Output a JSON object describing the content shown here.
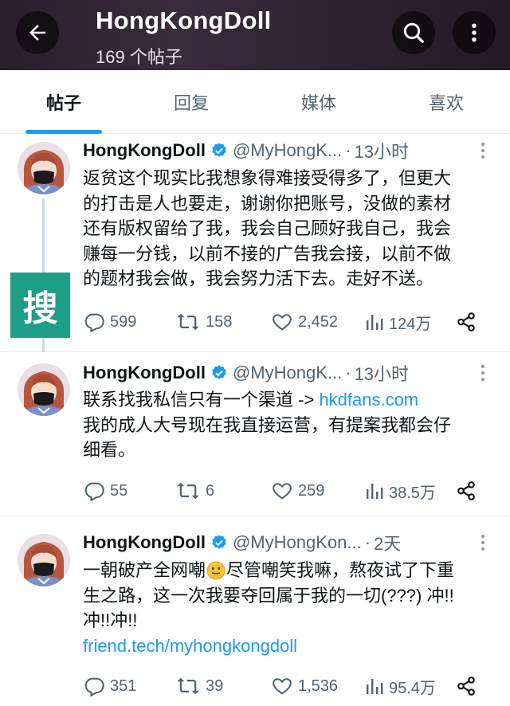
{
  "header": {
    "title": "HongKongDoll",
    "subtitle": "169 个帖子",
    "back_icon": "arrow-left-icon",
    "search_icon": "search-icon",
    "more_icon": "more-vertical-icon"
  },
  "tabs": [
    {
      "label": "帖子",
      "active": true
    },
    {
      "label": "回复",
      "active": false
    },
    {
      "label": "媒体",
      "active": false
    },
    {
      "label": "喜欢",
      "active": false
    }
  ],
  "colors": {
    "accent": "#1d9bf0",
    "text": "#0f1419",
    "muted": "#536471",
    "header_bg": "#2c2130",
    "watermark": "#1e9e86"
  },
  "posts": [
    {
      "name": "HongKongDoll",
      "handle": "@MyHongK...",
      "dot": "·",
      "time": "13小时",
      "lines": [
        "返贫这个现实比我想象得难接受得多了，但更大",
        "的打击是人也要走，谢谢你把账号，没做的素材",
        "还有版权留给了我，我会自己顾好我自己，我会",
        "赚每一分钱，以前不接的广告我会接，以前不做",
        "的题材我会做，我会努力活下去。走好不送。"
      ],
      "replies": "599",
      "reposts": "158",
      "likes": "2,452",
      "views": "124万"
    },
    {
      "name": "HongKongDoll",
      "handle": "@MyHongK...",
      "dot": "·",
      "time": "13小时",
      "line1_text": "联系找我私信只有一个渠道 -> ",
      "line1_link": "hkdfans.com",
      "lines": [
        "我的成人大号现在我直接运营，有提案我都会仔",
        "细看。"
      ],
      "replies": "55",
      "reposts": "6",
      "likes": "259",
      "views": "38.5万"
    },
    {
      "name": "HongKongDoll",
      "handle": "@MyHongKon...",
      "dot": "·",
      "time": "2天",
      "line1_a": "一朝破产全网嘲",
      "line1_b": "尽管嘲笑我嘛，熬夜试了下重",
      "lines": [
        "生之路，这一次我要夺回属于我的一切(???) 冲!!",
        "冲!!冲!!"
      ],
      "link": "friend.tech/myhongkongdoll",
      "replies": "351",
      "reposts": "39",
      "likes": "1,536",
      "views": "95.4万"
    }
  ],
  "watermark_glyph": "搜"
}
